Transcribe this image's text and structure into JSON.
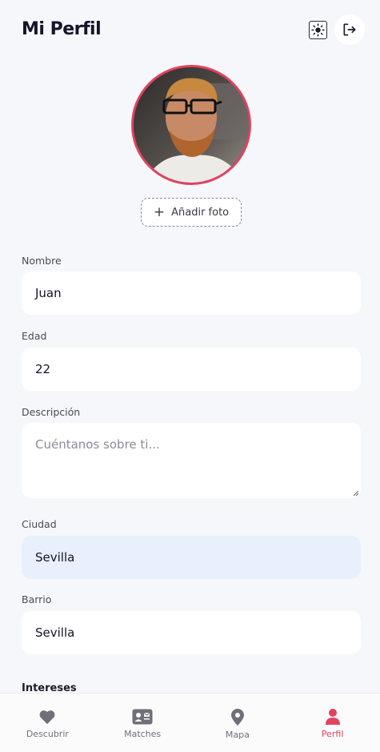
{
  "header": {
    "title": "Mi Perfil",
    "theme_icon": "sun-icon",
    "logout_icon": "logout-icon"
  },
  "profile_photo": {
    "add_label": "Añadir foto",
    "add_icon": "plus-icon"
  },
  "form": {
    "nombre": {
      "label": "Nombre",
      "value": "Juan"
    },
    "edad": {
      "label": "Edad",
      "value": "22"
    },
    "descripcion": {
      "label": "Descripción",
      "value": "",
      "placeholder": "Cuéntanos sobre ti..."
    },
    "ciudad": {
      "label": "Ciudad",
      "value": "Sevilla"
    },
    "barrio": {
      "label": "Barrio",
      "value": "Sevilla"
    },
    "next_section": "Intereses"
  },
  "nav": {
    "items": [
      {
        "label": "Descubrir",
        "icon": "heart-icon"
      },
      {
        "label": "Matches",
        "icon": "contact-card-icon"
      },
      {
        "label": "Mapa",
        "icon": "map-pin-icon"
      },
      {
        "label": "Perfil",
        "icon": "user-icon"
      }
    ],
    "active": "Perfil"
  },
  "colors": {
    "accent": "#e1435f",
    "background": "#f6f7fa",
    "field_filled": "#e8effd"
  }
}
